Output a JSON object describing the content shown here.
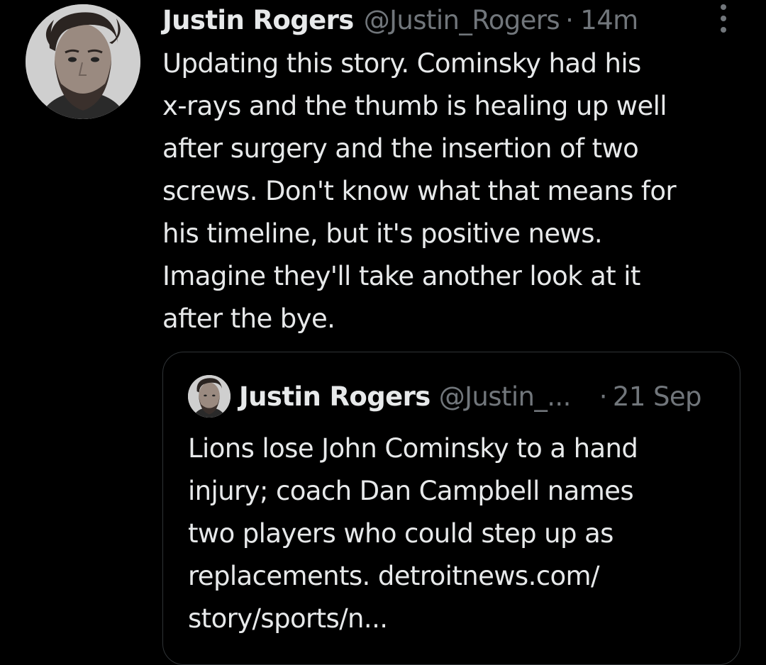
{
  "tweet": {
    "author_name": "Justin Rogers",
    "author_handle": "@Justin_Rogers",
    "separator": "·",
    "time": "14m",
    "text": "Updating this story. Cominsky had his\nx-rays and the thumb is healing up well\nafter surgery and the insertion of two\nscrews. Don't know what that means for\nhis timeline, but it's positive news.\nImagine they'll take another look at it\nafter the bye."
  },
  "quoted_tweet": {
    "author_name": "Justin Rogers",
    "author_handle": "@Justin_...",
    "separator": "·",
    "time": "21 Sep",
    "text": "Lions lose John Cominsky to a hand\ninjury; coach Dan Campbell names\ntwo players who could step up as\nreplacements. detroitnews.com/\nstory/sports/n..."
  },
  "icons": {
    "more": "more-options-icon",
    "avatar": "avatar"
  },
  "colors": {
    "background": "#000000",
    "primary_text": "#e7e9ea",
    "secondary_text": "#71767b",
    "border": "#2f3336"
  }
}
